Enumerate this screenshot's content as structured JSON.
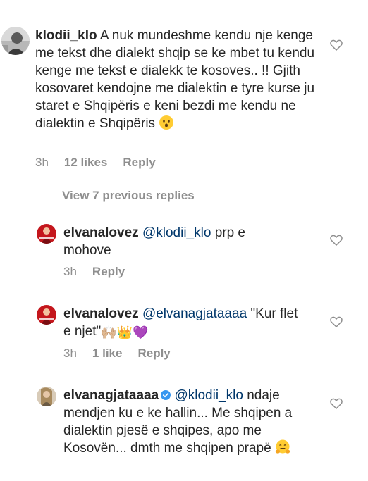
{
  "comments": [
    {
      "username": "klodii_klo",
      "text": "A nuk mundeshme kendu nje kenge me tekst dhe dialekt shqip se ke mbet tu kendu kenge me tekst e dialekk te kosoves.. !! Gjith kosovaret kendojne me dialektin e tyre kurse ju staret e Shqipëris e keni bezdi me kendu ne dialektin e Shqipëris",
      "emoji": "hushed-face-emoji",
      "time": "3h",
      "likes": "12 likes",
      "reply": "Reply"
    },
    {
      "username": "elvanalovez",
      "mention": "@klodii_klo",
      "text": "prp e mohove",
      "time": "3h",
      "reply": "Reply"
    },
    {
      "username": "elvanalovez",
      "mention": "@elvanagjataaaa",
      "text": "\"Kur flet e njet\"",
      "emoji_text": "🙌🏼👑💜",
      "time": "3h",
      "likes": "1 like",
      "reply": "Reply"
    },
    {
      "username": "elvanagjataaaa",
      "verified": true,
      "mention": "@klodii_klo",
      "text": "ndaje mendjen ku e ke hallin... Me shqipen a dialektin pjesë e shqipes, apo me Kosovën... dmth me shqipen prapë",
      "emoji": "hugging-face-emoji"
    }
  ],
  "view_replies": "View 7 previous replies",
  "colors": {
    "text": "#262626",
    "secondary": "#8e8e8e",
    "mention": "#00376b",
    "verified": "#3897f0"
  }
}
